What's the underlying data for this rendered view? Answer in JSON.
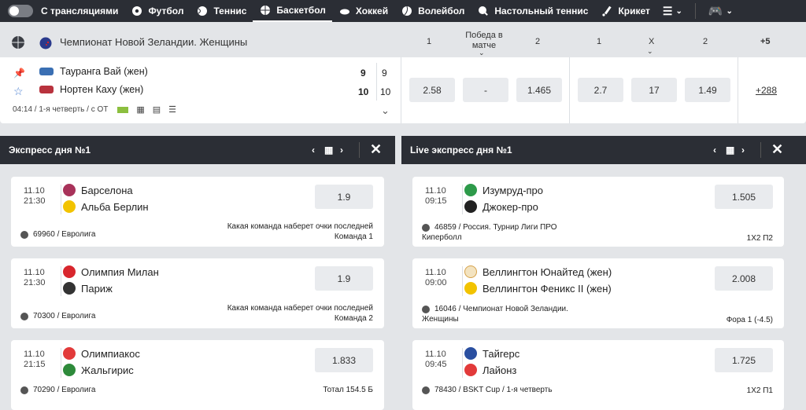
{
  "nav": {
    "toggle_label": "С трансляциями",
    "items": [
      {
        "label": "Футбол",
        "icon": "soccer-icon"
      },
      {
        "label": "Теннис",
        "icon": "tennis-icon"
      },
      {
        "label": "Баскетбол",
        "icon": "basketball-icon",
        "active": true
      },
      {
        "label": "Хоккей",
        "icon": "hockey-icon"
      },
      {
        "label": "Волейбол",
        "icon": "volleyball-icon"
      },
      {
        "label": "Настольный теннис",
        "icon": "table-tennis-icon"
      },
      {
        "label": "Крикет",
        "icon": "cricket-icon"
      }
    ]
  },
  "match": {
    "league": "Чемпионат Новой Зеландии. Женщины",
    "columns": {
      "c1": "1",
      "win_match": "Победа в матче",
      "c2": "2",
      "c3": "1",
      "cx": "X",
      "c4": "2",
      "more": "+5"
    },
    "team1": "Тауранга Вай (жен)",
    "team2": "Нортен Каху (жен)",
    "score1": "9",
    "score1b": "9",
    "score2": "10",
    "score2b": "10",
    "time_info": "04:14 / 1-я четверть / с ОТ",
    "odds": [
      "2.58",
      "-",
      "1.465",
      "2.7",
      "17",
      "1.49"
    ],
    "more_link": "+288"
  },
  "panels": [
    {
      "title": "Экспресс дня №1",
      "cards": [
        {
          "date": "11.10",
          "time": "21:30",
          "team1": "Барселона",
          "team2": "Альба Берлин",
          "coef": "1.9",
          "bet_line1": "Какая команда наберет очки последней",
          "bet_line2": "Команда 1",
          "league": "69960 / Евролига"
        },
        {
          "date": "11.10",
          "time": "21:30",
          "team1": "Олимпия Милан",
          "team2": "Париж",
          "coef": "1.9",
          "bet_line1": "Какая команда наберет очки последней",
          "bet_line2": "Команда 2",
          "league": "70300 / Евролига"
        },
        {
          "date": "11.10",
          "time": "21:15",
          "team1": "Олимпиакос",
          "team2": "Жальгирис",
          "coef": "1.833",
          "bet_line1": "Тотал 154.5 Б",
          "bet_line2": "",
          "league": "70290 / Евролига"
        }
      ]
    },
    {
      "title": "Live экспресс дня №1",
      "cards": [
        {
          "date": "11.10",
          "time": "09:15",
          "team1": "Изумруд-про",
          "team2": "Джокер-про",
          "coef": "1.505",
          "bet_line1": "1X2 П2",
          "bet_line2": "",
          "league": "46859 / Россия. Турнир Лиги ПРО",
          "league2": "Киперболл"
        },
        {
          "date": "11.10",
          "time": "09:00",
          "team1": "Веллингтон Юнайтед (жен)",
          "team2": "Веллингтон Феникс II (жен)",
          "coef": "2.008",
          "bet_line1": "Фора 1 (-4.5)",
          "bet_line2": "",
          "league": "16046 / Чемпионат Новой Зеландии.",
          "league2": "Женщины"
        },
        {
          "date": "11.10",
          "time": "09:45",
          "team1": "Тайгерс",
          "team2": "Лайонз",
          "coef": "1.725",
          "bet_line1": "1X2 П1",
          "bet_line2": "",
          "league": "78430 / BSKT Cup / 1-я четверть",
          "league2": ""
        }
      ]
    }
  ]
}
